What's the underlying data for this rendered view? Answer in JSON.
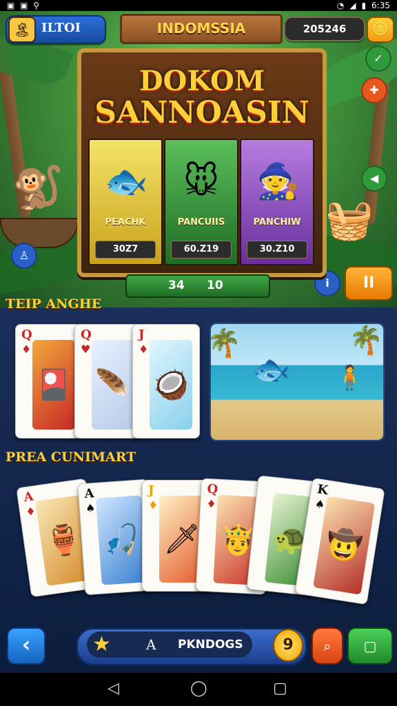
{
  "status_bar": {
    "left_icons": "▣ ▣ ⚲",
    "time": "6:35"
  },
  "header": {
    "player_name": "ILTOI",
    "title": "INDOMSSIA",
    "coins": "205246"
  },
  "slot_machine": {
    "title_line1": "DOKOM",
    "title_line2": "SANNOASIN",
    "reels": [
      {
        "label": "PEACHK",
        "value": "30Z7"
      },
      {
        "label": "PANCUIIS",
        "value": "60.Z19"
      },
      {
        "label": "PANCHIW",
        "value": "30.Z10"
      }
    ],
    "win_left": "34",
    "win_right": "10",
    "pause_label": "II"
  },
  "sections": {
    "top_title": "TEIP ANGHE",
    "bottom_title": "PREA CUNIMART"
  },
  "top_cards": [
    {
      "rank": "Q",
      "suit": "♦"
    },
    {
      "rank": "Q",
      "suit": "♥"
    },
    {
      "rank": "J",
      "suit": "♦"
    }
  ],
  "bottom_cards": [
    {
      "rank": "A",
      "suit": "♦"
    },
    {
      "rank": "A",
      "suit": "♠"
    },
    {
      "rank": "J",
      "suit": "♦"
    },
    {
      "rank": "Q",
      "suit": "♦"
    },
    {
      "rank": "",
      "suit": ""
    },
    {
      "rank": "K",
      "suit": "♠"
    }
  ],
  "bottom_bar": {
    "search_letter": "A",
    "search_label": "PKNDOGS",
    "coin_value": "9"
  },
  "colors": {
    "accent_gold": "#ffcf3a",
    "panel_blue": "#1a2f5a",
    "win_green": "#3fa845",
    "pause_orange": "#ffb338"
  },
  "icons": [
    "search-icon",
    "star-icon",
    "back-arrow-icon",
    "pause-icon",
    "triangle-back-icon",
    "circle-home-icon",
    "square-recents-icon"
  ]
}
